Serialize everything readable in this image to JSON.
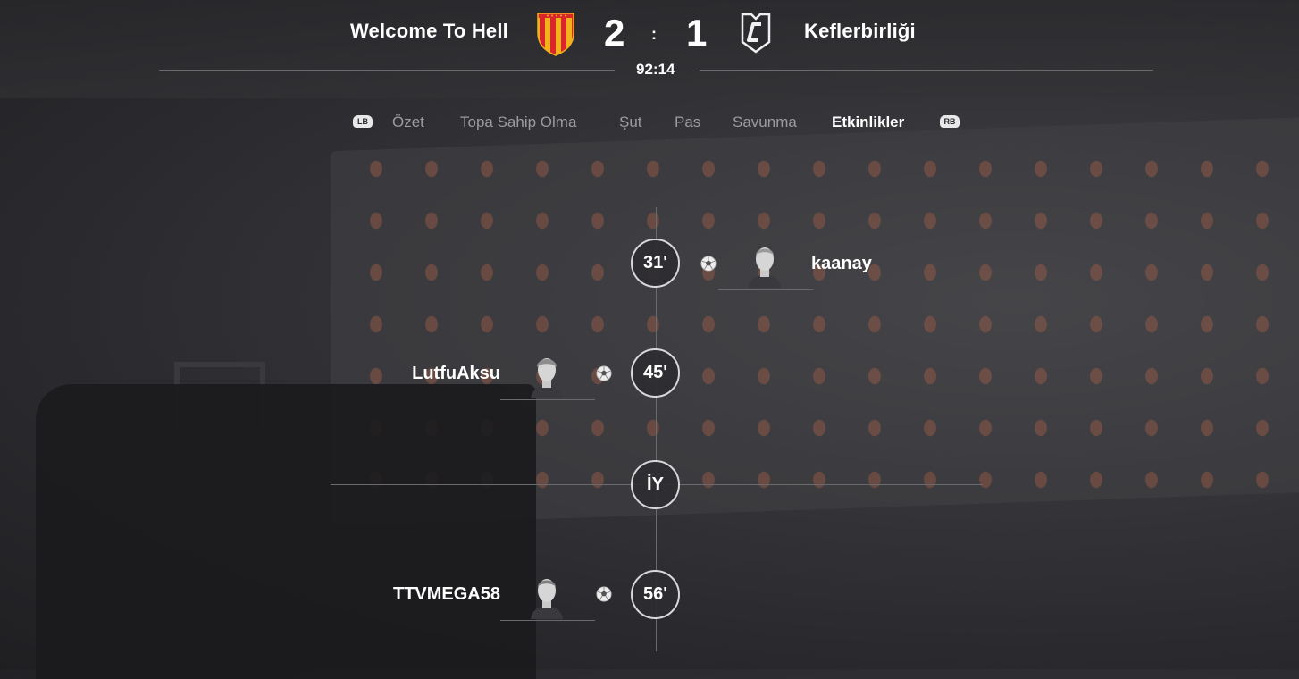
{
  "match": {
    "home": {
      "name": "Welcome To Hell",
      "score": "2",
      "crest_icon": "red-yellow-striped-shield-crest"
    },
    "away": {
      "name": "Keflerbirliği",
      "score": "1",
      "crest_icon": "white-c-shield-crest"
    },
    "separator": ":",
    "clock": "92:14"
  },
  "tabs": {
    "left_bumper": "LB",
    "right_bumper": "RB",
    "items": [
      {
        "label": "Özet",
        "active": false
      },
      {
        "label": "Topa Sahip Olma",
        "active": false
      },
      {
        "label": "Şut",
        "active": false
      },
      {
        "label": "Pas",
        "active": false
      },
      {
        "label": "Savunma",
        "active": false
      },
      {
        "label": "Etkinlikler",
        "active": true
      }
    ]
  },
  "events": [
    {
      "minute": "31'",
      "side": "away",
      "type": "goal",
      "icon": "soccer-ball-icon",
      "player": "kaanay"
    },
    {
      "minute": "45'",
      "side": "home",
      "type": "goal",
      "icon": "soccer-ball-icon",
      "player": "LutfuAksu"
    },
    {
      "minute": "56'",
      "side": "home",
      "type": "goal",
      "icon": "soccer-ball-icon",
      "player": "TTVMEGA58"
    }
  ],
  "half_time_marker": "İY",
  "colors": {
    "text": "#ffffff",
    "inactive_tab": "#9c9ca0",
    "line": "#6a6a6e",
    "crest_red": "#d8262b",
    "crest_yellow": "#f2b21c"
  }
}
